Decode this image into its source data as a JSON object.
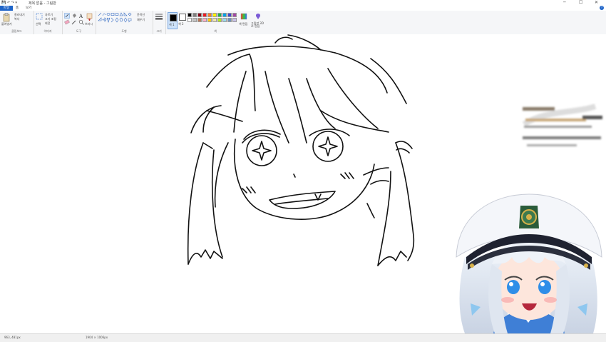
{
  "window": {
    "title": "제목 없음 - 그림판",
    "quick_access": "💾 ↶ ↷ ▾",
    "controls": [
      "─",
      "☐",
      "✕"
    ]
  },
  "tabs": {
    "file": "파일",
    "home": "홈",
    "view": "보기"
  },
  "ribbon": {
    "clipboard": {
      "label": "클립보드",
      "paste": "붙여넣기",
      "cut": "잘라내기",
      "copy": "복사"
    },
    "image": {
      "label": "이미지",
      "select": "선택",
      "crop": "자르기",
      "resize": "크기 조정",
      "rotate": "회전"
    },
    "tools": {
      "label": "도구",
      "brushes": "브러시"
    },
    "shapes": {
      "label": "도형",
      "outline": "윤곽선",
      "fill": "채우기"
    },
    "size": {
      "label": "크기"
    },
    "colors": {
      "label": "색",
      "color1": "색 1",
      "color2": "색 2",
      "edit": "색 편집",
      "paint3d": "그림판 3D로 편집",
      "palette": [
        "#000000",
        "#7f7f7f",
        "#880015",
        "#ed1c24",
        "#ff7f27",
        "#fff200",
        "#22b14c",
        "#00a2e8",
        "#3f48cc",
        "#a349a4",
        "#ffffff",
        "#c3c3c3",
        "#b97a57",
        "#ffaec9",
        "#ffc90e",
        "#efe4b0",
        "#b5e61d",
        "#99d9ea",
        "#7092be",
        "#c8bfe7"
      ],
      "color1_value": "#000000",
      "color2_value": "#ffffff"
    }
  },
  "status": {
    "cursor": "963, 481px",
    "size": "1904 × 1006px"
  }
}
